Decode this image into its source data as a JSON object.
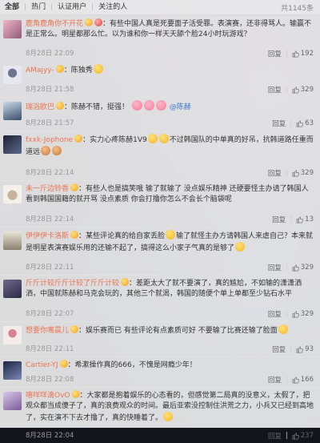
{
  "tabs": {
    "all": "全部",
    "hot": "热门",
    "verified": "认证用户",
    "following": "关注的人",
    "count": "共1145条"
  },
  "comments": [
    {
      "name": "鹿角鹿角你不开花",
      "text": "：有些中国人真是死要面子活受罪。表演赛，还非得骂人。输赢不是正常么。明星都那么忙。以为谁和你一样天天舔个脸24小时玩游戏？",
      "time": "8月28日 22:09",
      "reply": "回复",
      "likes": "192",
      "avatar_colors": [
        "#f2b6c6",
        "#8f5b7a"
      ]
    },
    {
      "name": "AMajyy-",
      "text": "：陈独秀",
      "time": "8月28日 21:58",
      "reply": "回复",
      "likes": "329",
      "avatar_colors": [
        "#e7e7ef",
        "#6f7390"
      ]
    },
    {
      "name": "瑞浴欧巴",
      "text": "：陈赫不错，挺强！",
      "mention": "@陈赫",
      "time": "8月28日 21:57",
      "reply": "回复",
      "likes": "63",
      "avatar_colors": [
        "#c9dbe6",
        "#3b4c6b"
      ]
    },
    {
      "name": "fxxk-Jophone",
      "text": "：实力心疼陈赫1V9",
      "text2": "不过韩国队的中单真的好吊，抗韩道路任重而道远",
      "time": "8月28日 22:14",
      "reply": "回复",
      "likes": "329",
      "avatar_colors": [
        "#1d2233",
        "#5b6a8c"
      ]
    },
    {
      "name": "未一斤边铃香",
      "text": "：有些人也是搞笑哦 输了就输了 没点娱乐精神 还硬要怪主办请了韩国人 看到韩国国籍的就开骂 没点素质 你会打撸你怎么不会长个脑袋呢",
      "time": "8月28日 22:14",
      "reply": "回复",
      "likes": "13",
      "avatar_colors": [
        "#f3f1ec",
        "#d8c8b4"
      ]
    },
    {
      "name": "伊伊伊卡洛斯",
      "text": "：某些评论真的给自家丢脸",
      "text2": "输了就怪主办方请韩国人来虐自己？本来就是明星表演赛娱乐用的还输不起了，搞得这么小家子气真的是够了",
      "time": "8月28日 22:11",
      "reply": "回复",
      "likes": "329",
      "avatar_colors": [
        "#e9e4d6",
        "#8a8070"
      ]
    },
    {
      "name": "斤斤计较斤斤计较了斤斤计较",
      "text": "：差距太大了就不要演了，真的尴尬，不如输的潇潇洒洒，中国就陈赫和马克会玩的，其他三个就渴，韩国的随便个单上单都至少钻石水平",
      "time": "8月28日 22:07",
      "reply": "回复",
      "likes": "329",
      "avatar_colors": [
        "#6f6a8c",
        "#2c2a44"
      ]
    },
    {
      "name": "想要你嘴晨儿",
      "text": "：娱乐赛而已 有些评论有点素质可好 不要输了比赛还输了脸面",
      "time": "8月28日 22:11",
      "reply": "回复",
      "likes": "93",
      "avatar_colors": [
        "#f5ece9",
        "#d77f94"
      ]
    },
    {
      "name": "Cartier-YJ",
      "text": "：希漱操作真的666，不愧是网瘾少年！",
      "time": "8月28日 22:08",
      "reply": "回复",
      "likes": "166",
      "avatar_colors": [
        "#1c2540",
        "#7b88b6"
      ]
    },
    {
      "name": "嘻咩咩滴OvO",
      "text": "：大家都是抱着娱乐的心态看的，但感觉第二局真的没意义，太假了，把观众都当成傻子了，真的浪费观众的时间。最后亚索没控制住洪荒之力，小兵又已经到高地了，实在演不下去才撸了，真的快睡着了。",
      "time": "8月28日 22:04",
      "reply": "回复",
      "likes": "237",
      "avatar_colors": [
        "#d9c9e6",
        "#7a5b9c"
      ]
    }
  ]
}
